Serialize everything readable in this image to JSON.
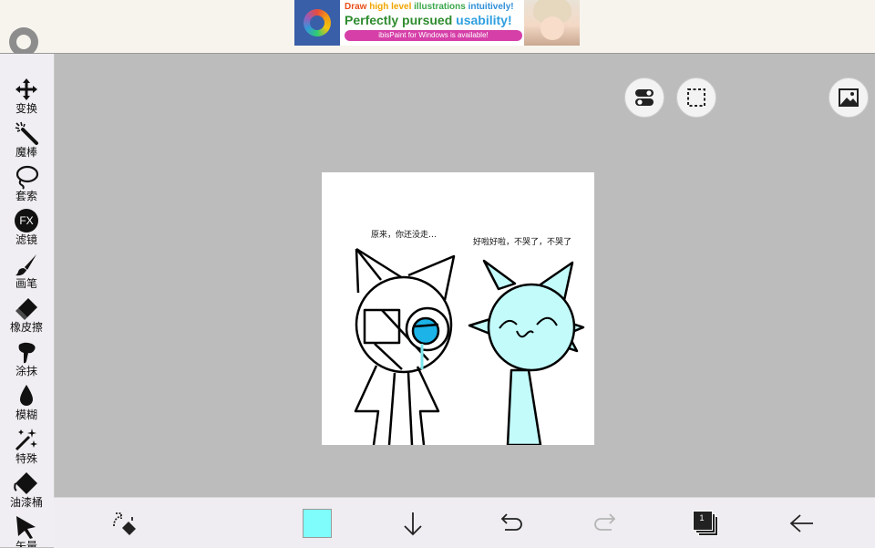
{
  "ad": {
    "line1_word1": "Draw ",
    "line1_word2": "high level ",
    "line1_word3": "illustrations ",
    "line1_word4": "intuitively!",
    "line2_part1": "Perfectly pursued ",
    "line2_part2": "usability!",
    "line3": "ibisPaint for Windows is available!"
  },
  "toolbar": {
    "items": [
      {
        "label": "变换",
        "icon": "move-arrows-icon"
      },
      {
        "label": "魔棒",
        "icon": "magic-wand-icon"
      },
      {
        "label": "套索",
        "icon": "lasso-icon"
      },
      {
        "label": "滤镜",
        "icon": "fx-icon",
        "icon_text": "FX"
      },
      {
        "label": "画笔",
        "icon": "brush-icon"
      },
      {
        "label": "橡皮擦",
        "icon": "eraser-icon"
      },
      {
        "label": "涂抹",
        "icon": "smudge-icon"
      },
      {
        "label": "模糊",
        "icon": "blur-drop-icon"
      },
      {
        "label": "特殊",
        "icon": "sparkle-icon"
      },
      {
        "label": "油漆桶",
        "icon": "paint-bucket-icon"
      },
      {
        "label": "矢量",
        "icon": "vector-cursor-icon"
      }
    ]
  },
  "canvas": {
    "speech_left": "原来，你还没走…",
    "speech_right": "好啦好啦，不哭了，不哭了"
  },
  "bottombar": {
    "color_swatch": "#7ffcfc",
    "layer_count": "1"
  },
  "colors": {
    "background": "#bcbcbc",
    "topbar": "#f7f4ee",
    "toolbar": "#f0eef2",
    "character_cyan": "#c3fbfb",
    "eye_blue": "#1bb3e8"
  }
}
